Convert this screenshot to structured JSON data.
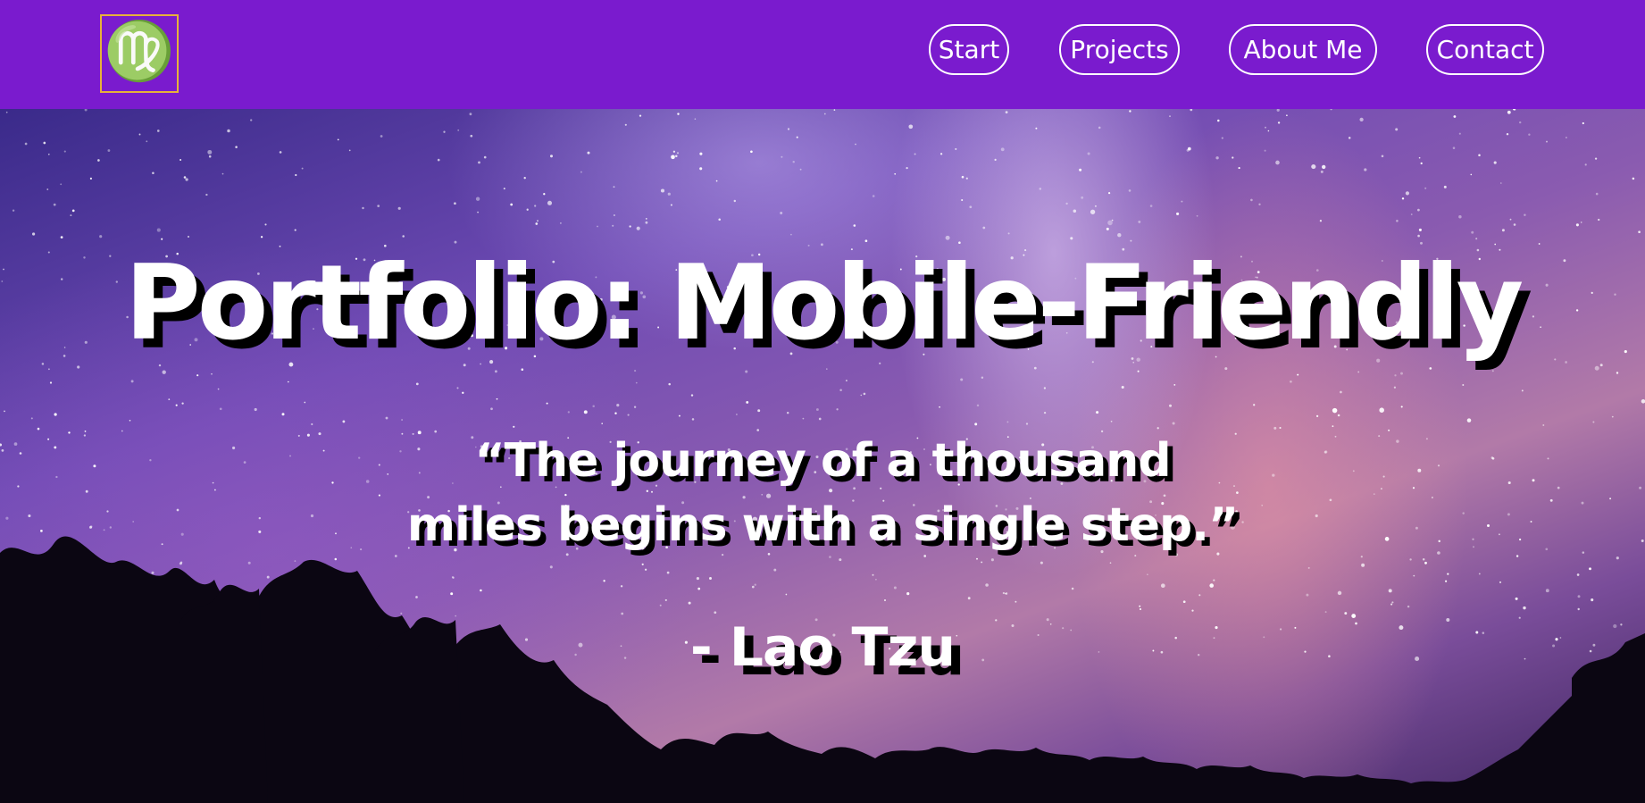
{
  "nav": {
    "logo_symbol": "♍",
    "items": [
      {
        "label": "Start"
      },
      {
        "label": "Projects"
      },
      {
        "label": "About Me"
      },
      {
        "label": "Contact"
      }
    ]
  },
  "hero": {
    "title": "Portfolio: Mobile-Friendly",
    "quote_line1": "“The journey of a thousand",
    "quote_line2": "miles begins with a single step.”",
    "author": "- Lao Tzu"
  },
  "colors": {
    "nav_background": "#7a1bce",
    "logo_border": "#e7b13a",
    "text": "#ffffff",
    "text_shadow": "#000000"
  }
}
